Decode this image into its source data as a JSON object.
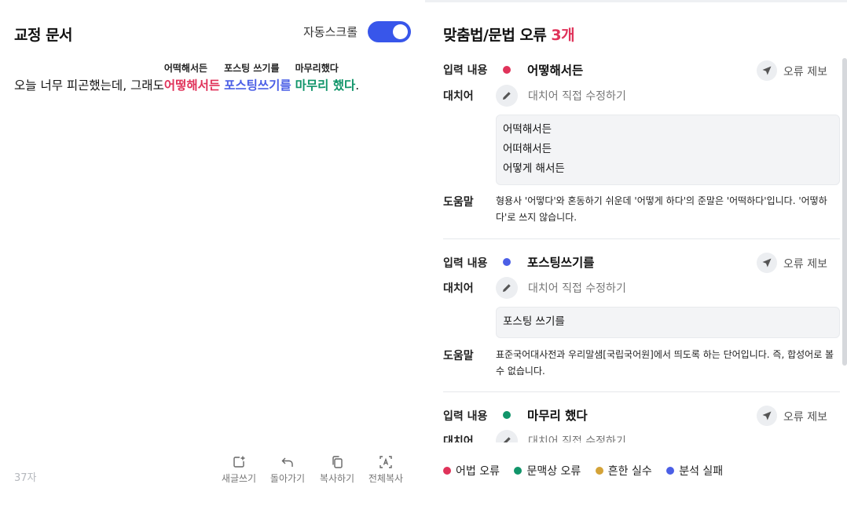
{
  "left": {
    "title": "교정 문서",
    "autoscroll_label": "자동스크롤",
    "autoscroll_on": true,
    "text": {
      "before": "오늘 너무 피곤했는데, 그래도 ",
      "errors": [
        {
          "word": "어떻해서든",
          "suggestion": "어떡해서든",
          "type": "grammar"
        },
        {
          "word": "포스팅쓰기를",
          "suggestion": "포스팅 쓰기를",
          "type": "analysis"
        },
        {
          "word": "마무리 했다",
          "suggestion": "마무리했다",
          "type": "context"
        }
      ],
      "after": "."
    },
    "char_count": "37자",
    "tools": [
      {
        "label": "새글쓰기",
        "icon": "new-post-icon"
      },
      {
        "label": "돌아가기",
        "icon": "undo-icon"
      },
      {
        "label": "복사하기",
        "icon": "copy-icon"
      },
      {
        "label": "전체복사",
        "icon": "copy-all-icon"
      }
    ]
  },
  "right": {
    "title": "맞춤법/문법 오류",
    "count": "3개",
    "labels": {
      "input": "입력 내용",
      "replacement": "대치어",
      "help": "도움말",
      "report": "오류 제보",
      "edit": "대치어 직접 수정하기"
    },
    "cards": [
      {
        "original": "어떻해서든",
        "color": "#e0335a",
        "suggestions": [
          "어떡해서든",
          "어떠해서든",
          "어떻게 해서든"
        ],
        "help": "형용사 '어떻다'와 혼동하기 쉬운데 '어떻게 하다'의 준말은 '어떡하다'입니다. '어떻하다'로 쓰지 않습니다."
      },
      {
        "original": "포스팅쓰기를",
        "color": "#4b5fe6",
        "suggestions": [
          "포스팅 쓰기를"
        ],
        "help": "표준국어대사전과 우리말샘[국립국어원]에서 띄도록 하는 단어입니다. 즉, 합성어로 볼 수 없습니다."
      },
      {
        "original": "마무리 했다",
        "color": "#11956a",
        "suggestions": [],
        "help": ""
      }
    ],
    "legend": [
      {
        "label": "어법 오류",
        "color": "#e0335a"
      },
      {
        "label": "문맥상 오류",
        "color": "#11956a"
      },
      {
        "label": "흔한 실수",
        "color": "#d4a338"
      },
      {
        "label": "분석 실패",
        "color": "#4b5fe6"
      }
    ]
  }
}
